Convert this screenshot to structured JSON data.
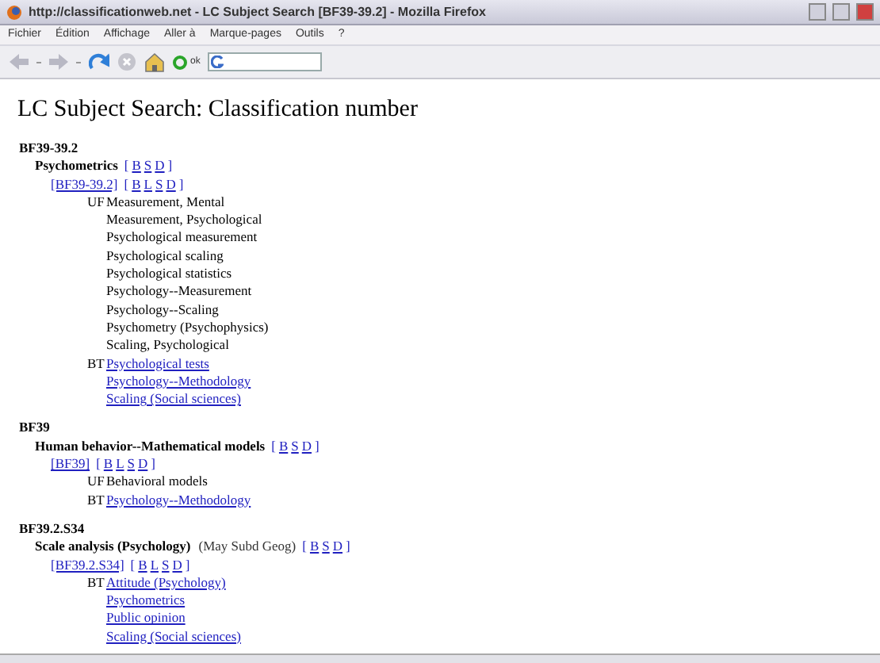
{
  "window": {
    "title": "http://classificationweb.net - LC Subject Search [BF39-39.2] - Mozilla Firefox"
  },
  "menu": [
    "Fichier",
    "Édition",
    "Affichage",
    "Aller à",
    "Marque-pages",
    "Outils",
    "?"
  ],
  "toolbar": {
    "go_label": "ok"
  },
  "page_title": "LC Subject Search: Classification number",
  "entries": [
    {
      "heading": "BF39-39.2",
      "term": "Psychometrics",
      "links": {
        "open": "[",
        "letters": [
          "B",
          "S",
          "D"
        ],
        "close": "]"
      },
      "class_number": "[BF39-39.2]",
      "class_links": {
        "open": "[",
        "letters": [
          "B",
          "L",
          "S",
          "D"
        ],
        "close": "]"
      },
      "relations": [
        {
          "label": "UF",
          "kind": "plain",
          "items": [
            "Measurement, Mental",
            "Measurement, Psychological",
            "Psychological measurement",
            "Psychological scaling",
            "Psychological statistics",
            "Psychology--Measurement",
            "Psychology--Scaling",
            "Psychometry (Psychophysics)",
            "Scaling, Psychological"
          ]
        },
        {
          "label": "BT",
          "kind": "link",
          "items": [
            "Psychological tests",
            "Psychology--Methodology",
            "Scaling (Social sciences)"
          ]
        }
      ]
    },
    {
      "heading": "BF39",
      "term": "Human behavior--Mathematical models",
      "links": {
        "open": "[",
        "letters": [
          "B",
          "S",
          "D"
        ],
        "close": "]"
      },
      "class_number": "[BF39]",
      "class_links": {
        "open": "[",
        "letters": [
          "B",
          "L",
          "S",
          "D"
        ],
        "close": "]"
      },
      "relations": [
        {
          "label": "UF",
          "kind": "plain",
          "items": [
            "Behavioral models"
          ]
        },
        {
          "label": "BT",
          "kind": "link",
          "items": [
            "Psychology--Methodology"
          ]
        }
      ]
    },
    {
      "heading": "BF39.2.S34",
      "term": "Scale analysis (Psychology)",
      "note": "(May Subd Geog)",
      "links": {
        "open": "[",
        "letters": [
          "B",
          "S",
          "D"
        ],
        "close": "]"
      },
      "class_number": "[BF39.2.S34]",
      "class_links": {
        "open": "[",
        "letters": [
          "B",
          "L",
          "S",
          "D"
        ],
        "close": "]"
      },
      "relations": [
        {
          "label": "BT",
          "kind": "link",
          "items": [
            "Attitude (Psychology)",
            "Psychometrics",
            "Public opinion",
            "Scaling (Social sciences)"
          ]
        }
      ]
    }
  ]
}
